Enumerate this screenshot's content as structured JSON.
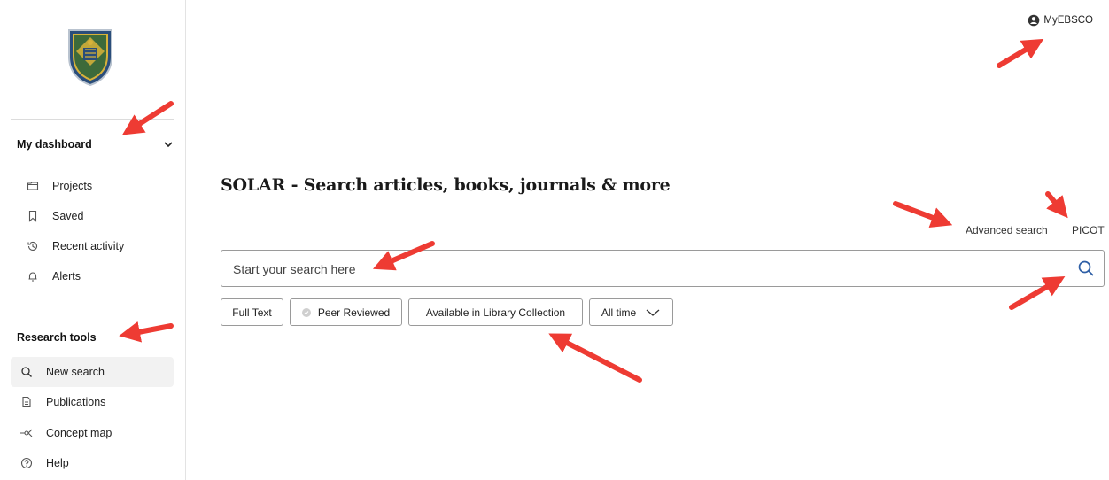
{
  "header": {
    "account_label": "MyEBSCO",
    "account_icon": "user-circle-icon"
  },
  "sidebar": {
    "dashboard": {
      "heading": "My dashboard",
      "items": [
        {
          "label": "Projects",
          "icon": "folder-icon"
        },
        {
          "label": "Saved",
          "icon": "bookmark-icon"
        },
        {
          "label": "Recent activity",
          "icon": "history-icon"
        },
        {
          "label": "Alerts",
          "icon": "bell-icon"
        }
      ]
    },
    "research": {
      "heading": "Research tools",
      "items": [
        {
          "label": "New search",
          "icon": "search-icon",
          "selected": true
        },
        {
          "label": "Publications",
          "icon": "document-icon"
        },
        {
          "label": "Concept map",
          "icon": "concept-map-icon"
        },
        {
          "label": "Help",
          "icon": "help-icon"
        }
      ]
    }
  },
  "main": {
    "title": "SOLAR - Search articles, books, journals & more",
    "advanced_search": "Advanced search",
    "picot": "PICOT",
    "search": {
      "placeholder": "Start your search here",
      "value": ""
    },
    "filters": {
      "full_text": "Full Text",
      "peer_reviewed": "Peer Reviewed",
      "library_collection": "Available in Library Collection",
      "time": "All time"
    }
  },
  "colors": {
    "annotation_arrow": "#ee3b33",
    "crest_blue": "#2a4d7a",
    "crest_gold": "#d8b23a",
    "search_icon": "#2f5fa6"
  }
}
